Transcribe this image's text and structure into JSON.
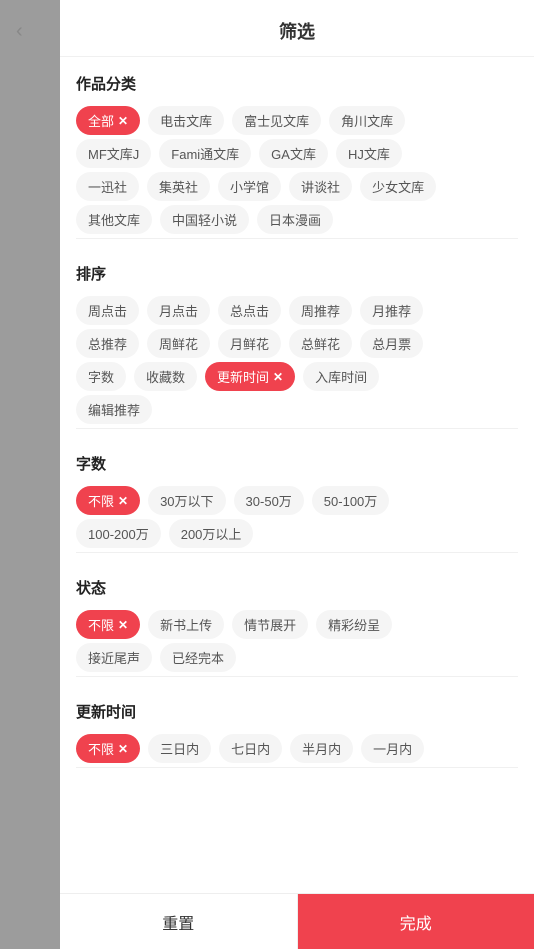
{
  "header": {
    "title": "筛选",
    "back_icon": "‹"
  },
  "sections": [
    {
      "id": "category",
      "title": "作品分类",
      "rows": [
        [
          "全部",
          "电击文库",
          "富士见文库",
          "角川文库"
        ],
        [
          "MF文库J",
          "Fami通文库",
          "GA文库",
          "HJ文库"
        ],
        [
          "一迅社",
          "集英社",
          "小学馆",
          "讲谈社",
          "少女文库"
        ],
        [
          "其他文库",
          "中国轻小说",
          "日本漫画"
        ]
      ],
      "active": "全部"
    },
    {
      "id": "sort",
      "title": "排序",
      "rows": [
        [
          "周点击",
          "月点击",
          "总点击",
          "周推荐",
          "月推荐"
        ],
        [
          "总推荐",
          "周鲜花",
          "月鲜花",
          "总鲜花",
          "总月票"
        ],
        [
          "字数",
          "收藏数",
          "更新时间",
          "入库时间"
        ],
        [
          "编辑推荐"
        ]
      ],
      "active": "更新时间"
    },
    {
      "id": "wordcount",
      "title": "字数",
      "rows": [
        [
          "不限",
          "30万以下",
          "30-50万",
          "50-100万"
        ],
        [
          "100-200万",
          "200万以上"
        ]
      ],
      "active": "不限"
    },
    {
      "id": "status",
      "title": "状态",
      "rows": [
        [
          "不限",
          "新书上传",
          "情节展开",
          "精彩纷呈"
        ],
        [
          "接近尾声",
          "已经完本"
        ]
      ],
      "active": "不限"
    },
    {
      "id": "updatetime",
      "title": "更新时间",
      "rows": [
        [
          "不限",
          "三日内",
          "七日内",
          "半月内",
          "一月内"
        ]
      ],
      "active": "不限"
    }
  ],
  "footer": {
    "reset_label": "重置",
    "confirm_label": "完成"
  }
}
